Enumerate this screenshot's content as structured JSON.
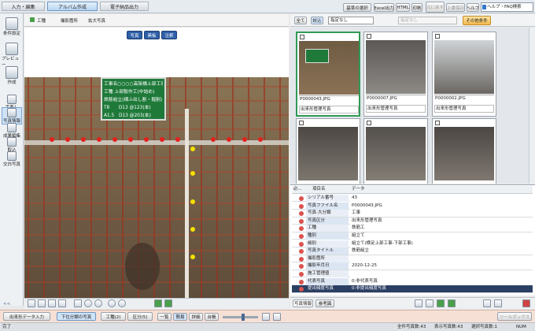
{
  "top_tabs": [
    "入力・編集",
    "アルバム作成",
    "電子納品出力"
  ],
  "header_buttons": [
    "基準の選択",
    "Excel出力",
    "HTML",
    "印刷",
    "元に戻す",
    "上書保存",
    "ヘルプ"
  ],
  "help_search": "ヘルプ・FAQ検索",
  "sidebar": [
    "条件設定",
    "プレビュー",
    "作成",
    "手差し",
    "写真情報",
    "成果編集",
    "取込",
    "交白写真"
  ],
  "crumbs": [
    "工種",
    "撮影箇所",
    "拡大写真"
  ],
  "photo_buttons": [
    "写真",
    "黒板",
    "注釈"
  ],
  "board_lines": [
    "工事名○○○○高架橋上部工事",
    "工種 上部製作工(中詰め)",
    "鉄筋組立(横ふ出し割・掘割)",
    "T8　　D13 @123(本)",
    "A1.5　D13 @203(本)"
  ],
  "filter": {
    "all": "全て",
    "narrow": "絞込",
    "select1": "指定なし",
    "select2": "指定なし",
    "other": "その他条件"
  },
  "thumbs": [
    {
      "file": "P0000043.JPG",
      "category": "出来形管理写真",
      "selected": true
    },
    {
      "file": "P0000007.JPG",
      "category": "出来形管理写真",
      "selected": false
    },
    {
      "file": "P0000002.JPG",
      "category": "出来形管理写真",
      "selected": false
    },
    {
      "file": "",
      "category": "",
      "selected": false
    },
    {
      "file": "",
      "category": "",
      "selected": false
    },
    {
      "file": "",
      "category": "",
      "selected": false
    }
  ],
  "prop_header": {
    "col1": "必...",
    "col2": "項目名",
    "col3": "データ"
  },
  "properties": [
    {
      "label": "シリアル番号",
      "value": "43",
      "color": "#d9534f"
    },
    {
      "label": "写真ファイル名",
      "value": "P0000043.JPG",
      "color": "#d9534f"
    },
    {
      "label": "写真-大分類",
      "value": "工事",
      "color": "#d9534f"
    },
    {
      "label": "写真区分",
      "value": "出来形管理写真",
      "color": "#d9534f"
    },
    {
      "label": "工種",
      "value": "鉄筋工",
      "color": "#d9534f"
    },
    {
      "label": "種別",
      "value": "組立て",
      "color": "#d9534f"
    },
    {
      "label": "細別",
      "value": "組立て(横足上部工事-下部工事)",
      "color": "#d9534f"
    },
    {
      "label": "写真タイトル",
      "value": "鉄筋組立",
      "color": "#d9534f"
    },
    {
      "label": "撮影箇所",
      "value": "",
      "color": "#d9534f"
    },
    {
      "label": "撮影年月日",
      "value": "2020-12-25",
      "color": "#d9534f"
    },
    {
      "label": "施工管理値",
      "value": "",
      "color": "#d9534f"
    },
    {
      "label": "代表写真",
      "value": "0:非代表写真",
      "color": "#d9534f"
    },
    {
      "label": "提出頻度写真",
      "value": "0:非提出頻度写真",
      "color": "#d9534f"
    }
  ],
  "prop_tabs": [
    "写真情報",
    "参考図"
  ],
  "bottom_toolbar": {
    "nav_back": "<<",
    "levels": [
      "一覧",
      "簡易",
      "詳細",
      "台帳"
    ]
  },
  "bottom_tabs": [
    "出来形データ入力",
    "下位分類の写真",
    "工種(2)",
    "区分(5)"
  ],
  "status": {
    "left": "完了",
    "total": "全件写真数:43",
    "display": "表示写真数:43",
    "selected": "選択写真数:1",
    "tool": "ツールボックス",
    "num": "NUM"
  }
}
